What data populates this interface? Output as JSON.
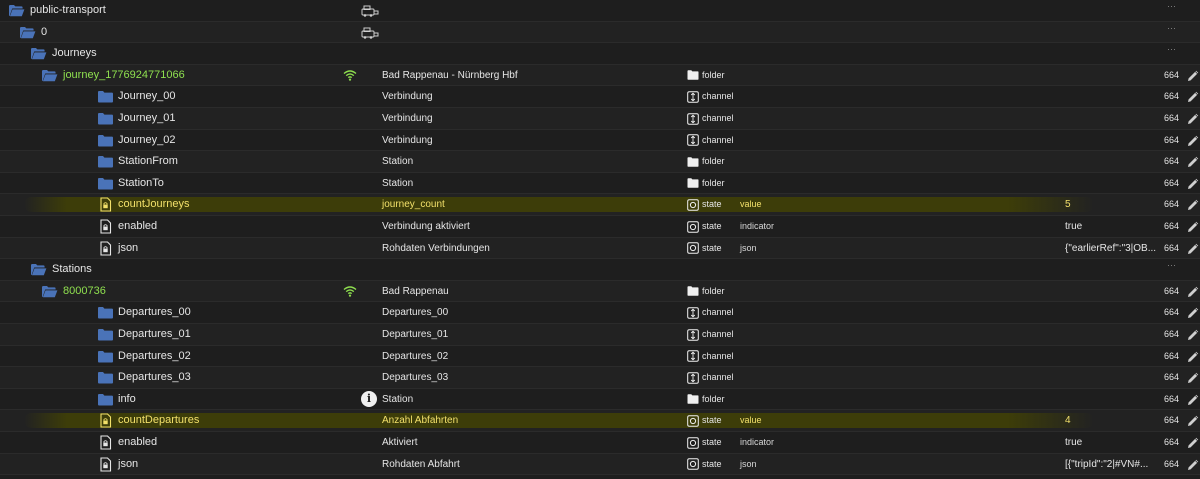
{
  "rows": [
    {
      "name": "public-transport",
      "indent": 0,
      "icon": "folder-open-icon",
      "desc": "",
      "type": "",
      "role": "",
      "value": "",
      "perm": "",
      "extra": "adapter-icon",
      "dots": true
    },
    {
      "name": "0",
      "indent": 1,
      "icon": "folder-open-icon",
      "desc": "",
      "type": "",
      "role": "",
      "value": "",
      "perm": "",
      "extra": "adapter-icon",
      "dots": true
    },
    {
      "name": "Journeys",
      "indent": 2,
      "icon": "folder-open-icon",
      "desc": "",
      "type": "",
      "role": "",
      "value": "",
      "perm": "",
      "extra": "",
      "dots": true
    },
    {
      "name": "journey_1776924771066",
      "indent": 3,
      "icon": "folder-open-icon",
      "color": "green",
      "desc": "Bad Rappenau - Nürnberg Hbf",
      "type": "folder",
      "role": "",
      "value": "",
      "perm": "664",
      "extra": "wifi-icon",
      "edit": true
    },
    {
      "name": "Journey_00",
      "indent": 4,
      "icon": "folder-icon",
      "desc": "Verbindung",
      "type": "channel",
      "role": "",
      "value": "",
      "perm": "664",
      "edit": true
    },
    {
      "name": "Journey_01",
      "indent": 4,
      "icon": "folder-icon",
      "desc": "Verbindung",
      "type": "channel",
      "role": "",
      "value": "",
      "perm": "664",
      "edit": true
    },
    {
      "name": "Journey_02",
      "indent": 4,
      "icon": "folder-icon",
      "desc": "Verbindung",
      "type": "channel",
      "role": "",
      "value": "",
      "perm": "664",
      "edit": true
    },
    {
      "name": "StationFrom",
      "indent": 4,
      "icon": "folder-icon",
      "desc": "Station",
      "type": "folder",
      "role": "",
      "value": "",
      "perm": "664",
      "edit": true
    },
    {
      "name": "StationTo",
      "indent": 4,
      "icon": "folder-icon",
      "desc": "Station",
      "type": "folder",
      "role": "",
      "value": "",
      "perm": "664",
      "edit": true
    },
    {
      "name": "countJourneys",
      "indent": 4,
      "icon": "document-icon",
      "color": "yellow",
      "highlight": true,
      "desc": "journey_count",
      "type": "state",
      "role": "value",
      "value": "5",
      "perm": "664",
      "edit": true
    },
    {
      "name": "enabled",
      "indent": 4,
      "icon": "document-icon",
      "desc": "Verbindung aktiviert",
      "type": "state",
      "role": "indicator",
      "value": "true",
      "perm": "664",
      "edit": true
    },
    {
      "name": "json",
      "indent": 4,
      "icon": "document-icon",
      "desc": "Rohdaten Verbindungen",
      "type": "state",
      "role": "json",
      "value": "{\"earlierRef\":\"3|OB...",
      "perm": "664",
      "edit": true
    },
    {
      "name": "Stations",
      "indent": 2,
      "icon": "folder-open-icon",
      "desc": "",
      "type": "",
      "role": "",
      "value": "",
      "perm": "",
      "extra": "",
      "dots": true
    },
    {
      "name": "8000736",
      "indent": 3,
      "icon": "folder-open-icon",
      "color": "green",
      "desc": "Bad Rappenau",
      "type": "folder",
      "role": "",
      "value": "",
      "perm": "664",
      "extra": "wifi-icon",
      "edit": true
    },
    {
      "name": "Departures_00",
      "indent": 4,
      "icon": "folder-icon",
      "desc": "Departures_00",
      "type": "channel",
      "role": "",
      "value": "",
      "perm": "664",
      "edit": true
    },
    {
      "name": "Departures_01",
      "indent": 4,
      "icon": "folder-icon",
      "desc": "Departures_01",
      "type": "channel",
      "role": "",
      "value": "",
      "perm": "664",
      "edit": true
    },
    {
      "name": "Departures_02",
      "indent": 4,
      "icon": "folder-icon",
      "desc": "Departures_02",
      "type": "channel",
      "role": "",
      "value": "",
      "perm": "664",
      "edit": true
    },
    {
      "name": "Departures_03",
      "indent": 4,
      "icon": "folder-icon",
      "desc": "Departures_03",
      "type": "channel",
      "role": "",
      "value": "",
      "perm": "664",
      "edit": true
    },
    {
      "name": "info",
      "indent": 4,
      "icon": "folder-icon",
      "desc": "Station",
      "type": "folder",
      "role": "",
      "value": "",
      "perm": "664",
      "extra": "info-icon",
      "edit": true
    },
    {
      "name": "countDepartures",
      "indent": 4,
      "icon": "document-icon",
      "color": "yellow",
      "highlight": true,
      "desc": "Anzahl Abfahrten",
      "type": "state",
      "role": "value",
      "value": "4",
      "perm": "664",
      "edit": true
    },
    {
      "name": "enabled",
      "indent": 4,
      "icon": "document-icon",
      "desc": "Aktiviert",
      "type": "state",
      "role": "indicator",
      "value": "true",
      "perm": "664",
      "edit": true
    },
    {
      "name": "json",
      "indent": 4,
      "icon": "document-icon",
      "desc": "Rohdaten Abfahrt",
      "type": "state",
      "role": "json",
      "value": "[{\"tripId\":\"2|#VN#...",
      "perm": "664",
      "edit": true
    }
  ],
  "dots_label": "···",
  "info_glyph": "i",
  "colors": {
    "folder": "#4a73b8",
    "green": "#8fe04f",
    "yellow": "#f2e06a",
    "background": "#1e1e1e"
  }
}
